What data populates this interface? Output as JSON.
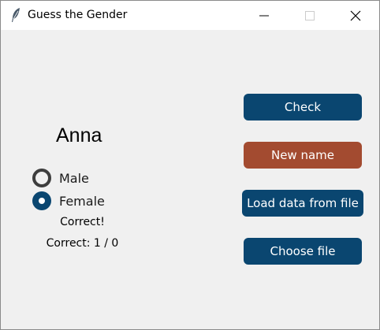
{
  "window": {
    "title": "Guess the Gender"
  },
  "app": {
    "name": "Anna",
    "options": [
      {
        "label": "Male",
        "selected": false
      },
      {
        "label": "Female",
        "selected": true
      }
    ],
    "result": "Correct!",
    "score": "Correct: 1 / 0"
  },
  "buttons": {
    "check": "Check",
    "new_name": "New name",
    "load": "Load data from file",
    "choose": "Choose file"
  },
  "colors": {
    "primary": "#0a4670",
    "accent": "#a34b30",
    "background": "#f0f0f0"
  },
  "icons": {
    "app": "feather-icon",
    "minimize": "minimize-icon",
    "maximize": "maximize-icon",
    "close": "close-icon"
  }
}
